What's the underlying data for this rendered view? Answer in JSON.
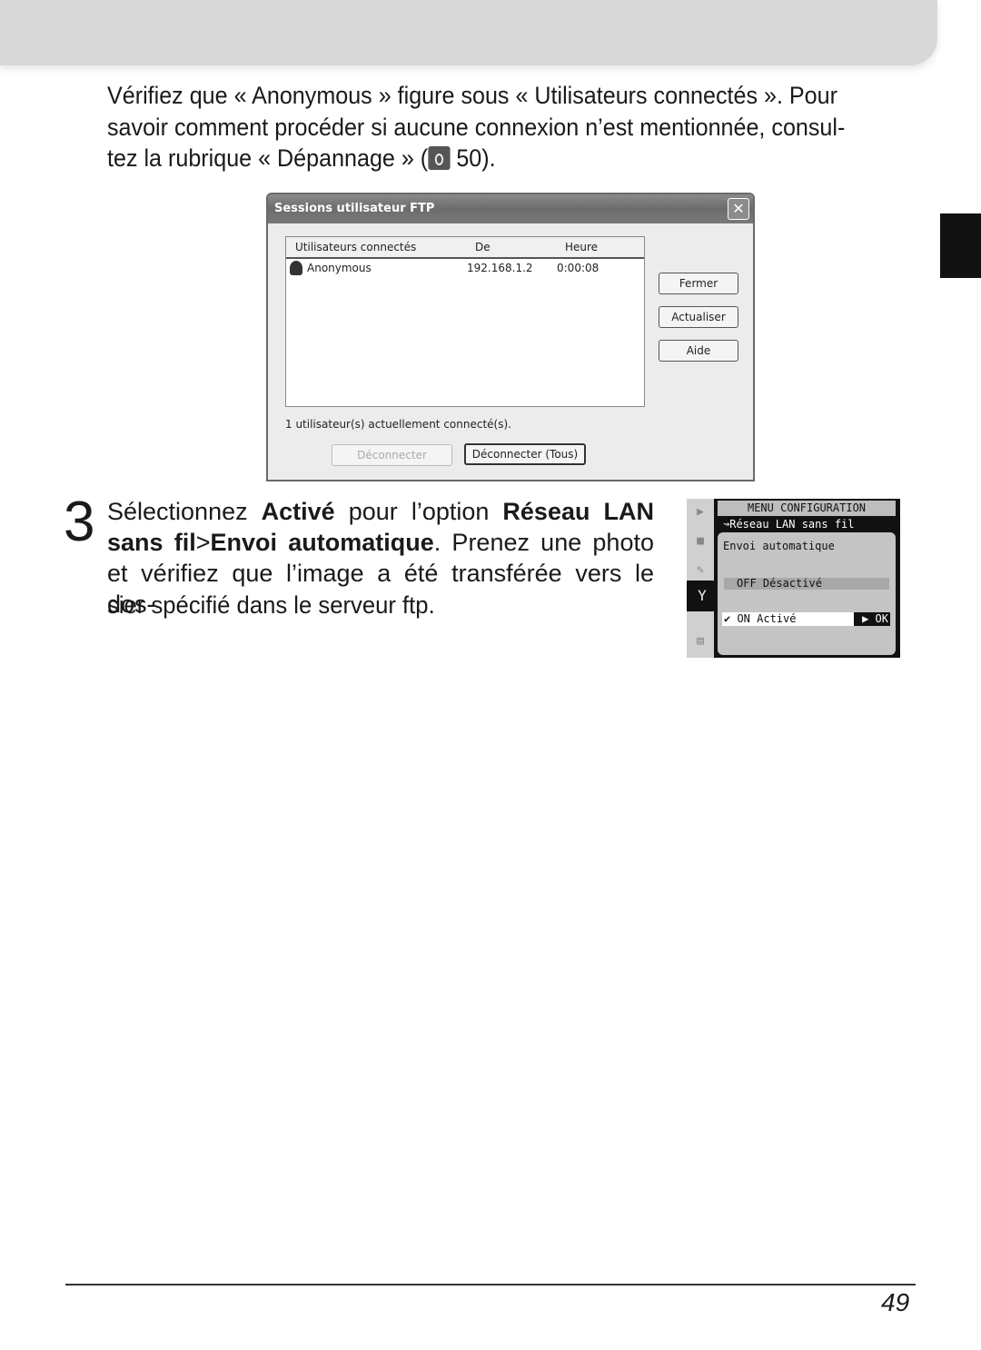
{
  "intro": {
    "line1": "Vérifiez que « Anonymous » figure sous « Utilisateurs connectés ». Pour",
    "line2": "savoir comment procéder si aucune connexion n’est mentionnée, consul-",
    "line3_pre": "tez la rubrique « Dépannage » (",
    "ref_icon": "troubleshooting-icon",
    "line3_post": " 50)."
  },
  "dialog": {
    "title": "Sessions utilisateur FTP",
    "close": "✕",
    "columns": [
      "Utilisateurs connectés",
      "De",
      "Heure"
    ],
    "rows": [
      {
        "user": "Anonymous",
        "from": "192.168.1.2",
        "time": "0:00:08"
      }
    ],
    "buttons": {
      "close": "Fermer",
      "refresh": "Actualiser",
      "help": "Aide",
      "disconnect": "Déconnecter",
      "disconnect_all": "Déconnecter (Tous)"
    },
    "status": "1 utilisateur(s) actuellement connecté(s)."
  },
  "step": {
    "number": "3",
    "l1a": "Sélectionnez ",
    "l1b": "Activé",
    "l1c": " pour l’option ",
    "l1d": "Réseau LAN",
    "l2a": "sans fil",
    "l2b": ">",
    "l2c": "Envoi automatique",
    "l2d": ". Prenez une photo",
    "l3": "et vérifiez que l’image a été transférée vers le dos-",
    "l4": "sier spécifié dans le serveur ftp."
  },
  "camera": {
    "header": "MENU CONFIGURATION",
    "sub": "↝Réseau LAN sans fil",
    "title": "Envoi automatique",
    "off": "OFF  Désactivé",
    "on": "✔ ON  Activé",
    "ok": "▶ OK"
  },
  "footer": {
    "page": "49"
  }
}
